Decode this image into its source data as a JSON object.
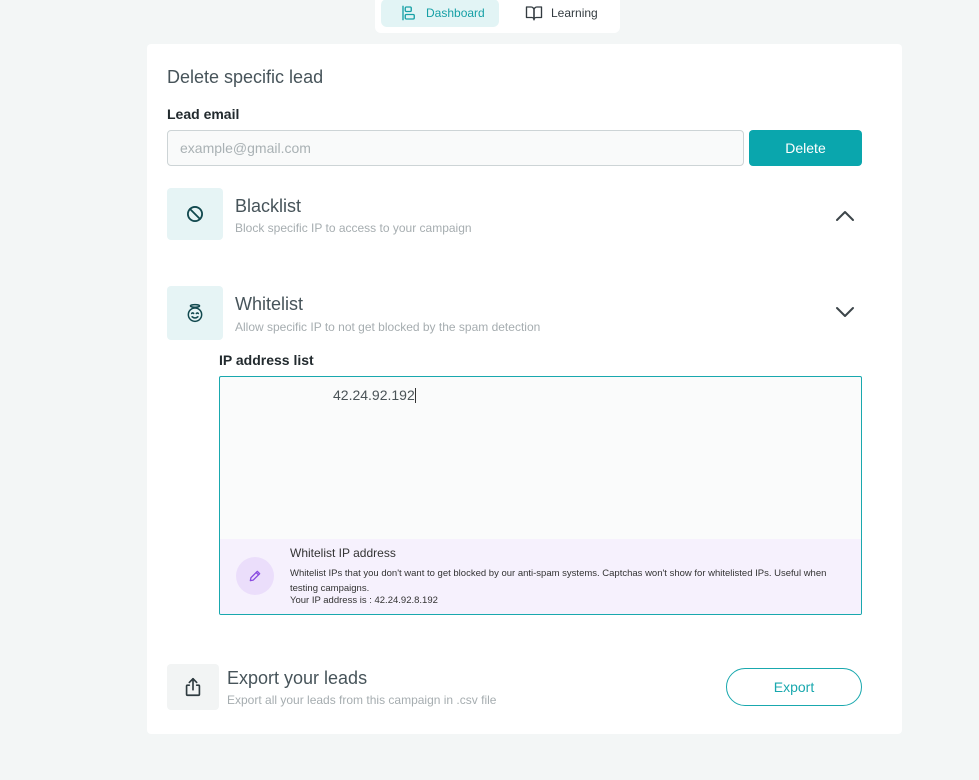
{
  "nav": {
    "tabs": [
      {
        "label": "Dashboard",
        "icon": "dashboard-icon",
        "active": true
      },
      {
        "label": "Learning",
        "icon": "book-open-icon",
        "active": false
      }
    ]
  },
  "delete_section": {
    "title": "Delete specific lead",
    "email_label": "Lead email",
    "email_placeholder": "example@gmail.com",
    "email_value": "",
    "delete_button": "Delete"
  },
  "blacklist": {
    "title": "Blacklist",
    "subtitle": "Block specific IP to access to your campaign",
    "icon": "ban-icon",
    "expanded_chevron": "chevron-up-icon"
  },
  "whitelist": {
    "title": "Whitelist",
    "subtitle": "Allow specific IP to not get blocked by the spam detection",
    "icon": "angel-face-icon",
    "chevron": "chevron-down-icon",
    "ip_list_label": "IP address list",
    "ip_list_value": "42.24.92.192",
    "info": {
      "title": "Whitelist IP address",
      "description": "Whitelist IPs that you don't want to get blocked by our anti-spam systems. Captchas won't show for whitelisted IPs. Useful when testing campaigns.",
      "your_ip": "Your IP address is : 42.24.92.8.192",
      "icon": "pencil-icon"
    }
  },
  "export": {
    "title": "Export your leads",
    "subtitle": "Export all your leads from this campaign in .csv file",
    "button": "Export",
    "icon": "upload-share-icon"
  },
  "colors": {
    "accent": "#0aa6ad",
    "page_bg": "#f3f6f6",
    "info_bg": "#f6f1fd"
  }
}
